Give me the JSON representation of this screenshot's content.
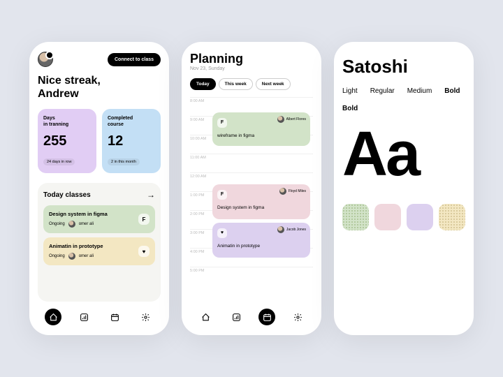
{
  "phone1": {
    "connectBtn": "Connect to class",
    "greeting": "Nice streak,\nAndrew",
    "stats": [
      {
        "label": "Days\nin tranning",
        "value": "255",
        "badge": "24 days in row"
      },
      {
        "label": "Completed\ncourse",
        "value": "12",
        "badge": "2 in this month"
      }
    ],
    "todayTitle": "Today classes",
    "arrow": "→",
    "classes": [
      {
        "title": "Design system in figma",
        "status": "Ongoing",
        "instructor": "omer ali",
        "glyph": "F"
      },
      {
        "title": "Animatin in prototype",
        "status": "Ongoing",
        "instructor": "omer ali",
        "glyph": "♥"
      }
    ]
  },
  "phone2": {
    "title": "Planning",
    "date": "Nov 23, Sunday",
    "chips": [
      "Today",
      "This week",
      "Next week"
    ],
    "times": [
      "8:00 AM",
      "9:00 AM",
      "10:00 AM",
      "11:00 AM",
      "12:00 AM",
      "1:00 PM",
      "2:00 PM",
      "3:00 PM",
      "4:00 PM",
      "5:00 PM"
    ],
    "events": [
      {
        "glyph": "F",
        "user": "Albert Flores",
        "title": "wireframe in figma"
      },
      {
        "glyph": "F",
        "user": "Floyd Miles",
        "title": "Design system in figma"
      },
      {
        "glyph": "♥",
        "user": "Jacob Jones",
        "title": "Animatin in prototype"
      }
    ]
  },
  "phone3": {
    "fontName": "Satoshi",
    "weights": [
      "Light",
      "Regular",
      "Medium",
      "Bold",
      "Bold"
    ],
    "sample": "Aa",
    "swatches": [
      "#d2e3c8",
      "#f0d7dd",
      "#dcd0ef",
      "#f3e7c2"
    ]
  }
}
